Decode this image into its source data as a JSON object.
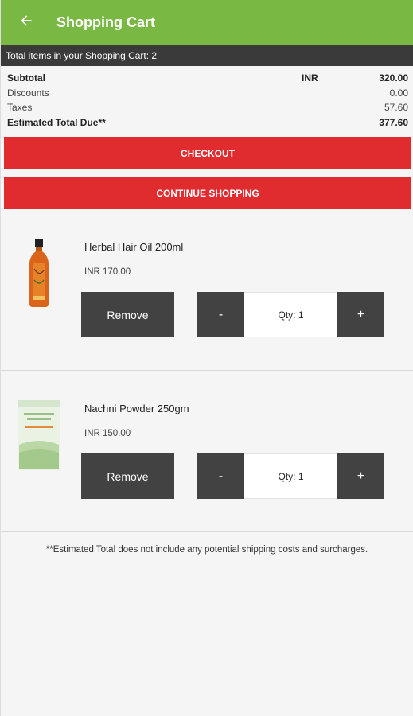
{
  "appbar": {
    "title": "Shopping Cart",
    "back_icon": "arrow-left-icon"
  },
  "cart_count_text": "Total items in your Shopping Cart: 2",
  "summary": {
    "subtotal_label": "Subtotal",
    "currency": "INR",
    "subtotal_value": "320.00",
    "discounts_label": "Discounts",
    "discounts_value": "0.00",
    "taxes_label": "Taxes",
    "taxes_value": "57.60",
    "total_label": "Estimated Total Due**",
    "total_value": "377.60"
  },
  "buttons": {
    "checkout": "CHECKOUT",
    "continue_shopping": "CONTINUE SHOPPING"
  },
  "items": [
    {
      "name": "Herbal Hair Oil 200ml",
      "price": "INR 170.00",
      "remove": "Remove",
      "minus": "-",
      "qty": "Qty: 1",
      "plus": "+"
    },
    {
      "name": "Nachni Powder 250gm",
      "price": "INR 150.00",
      "remove": "Remove",
      "minus": "-",
      "qty": "Qty: 1",
      "plus": "+"
    }
  ],
  "footnote": "**Estimated Total does not include any potential shipping costs and surcharges.",
  "colors": {
    "appbar": "#7ab844",
    "accent_red": "#e02b2f",
    "dark_button": "#424242"
  }
}
